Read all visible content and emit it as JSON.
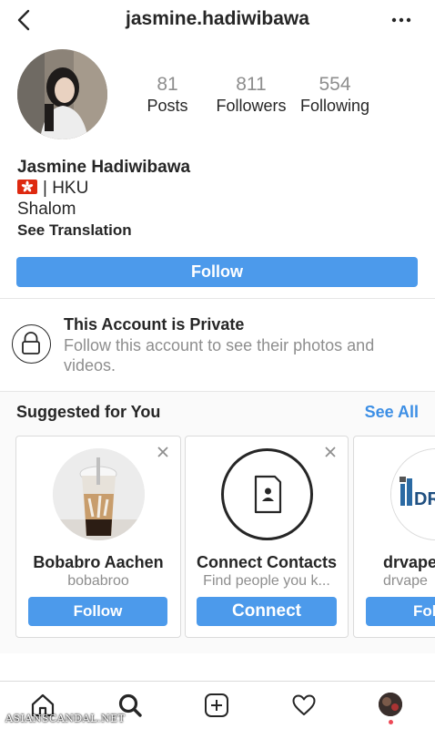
{
  "header": {
    "username": "jasmine.hadiwibawa",
    "back_icon": "chevron-left-icon",
    "more_icon": "more-horizontal-icon"
  },
  "profile": {
    "stats": {
      "posts_value": "81",
      "posts_label": "Posts",
      "followers_value": "811",
      "followers_label": "Followers",
      "following_value": "554",
      "following_label": "Following"
    },
    "full_name": "Jasmine Hadiwibawa",
    "bio_line1": "| HKU",
    "bio_line2": "Shalom",
    "see_translation": "See Translation",
    "follow_label": "Follow"
  },
  "private": {
    "title": "This Account is Private",
    "subtitle": "Follow this account to see their photos and videos."
  },
  "suggested": {
    "title": "Suggested for You",
    "see_all": "See All",
    "cards": [
      {
        "name": "Bobabro Aachen",
        "sub": "bobabroo",
        "button": "Follow"
      },
      {
        "name": "Connect Contacts",
        "sub": "Find people you k...",
        "button": "Connect"
      },
      {
        "name": "drvape",
        "sub": "drvape",
        "button": "Fol",
        "logo_text": "DR"
      }
    ]
  },
  "tabbar": {
    "items": [
      "home-icon",
      "search-icon",
      "new-post-icon",
      "activity-heart-icon",
      "profile-avatar"
    ]
  },
  "watermark": "ASIANSCANDAL.NET",
  "colors": {
    "primary_blue": "#4c9aeb",
    "link_blue": "#3d8fe5",
    "text": "#262626",
    "muted": "#8e8e8e",
    "notification_dot": "#ed4956"
  }
}
